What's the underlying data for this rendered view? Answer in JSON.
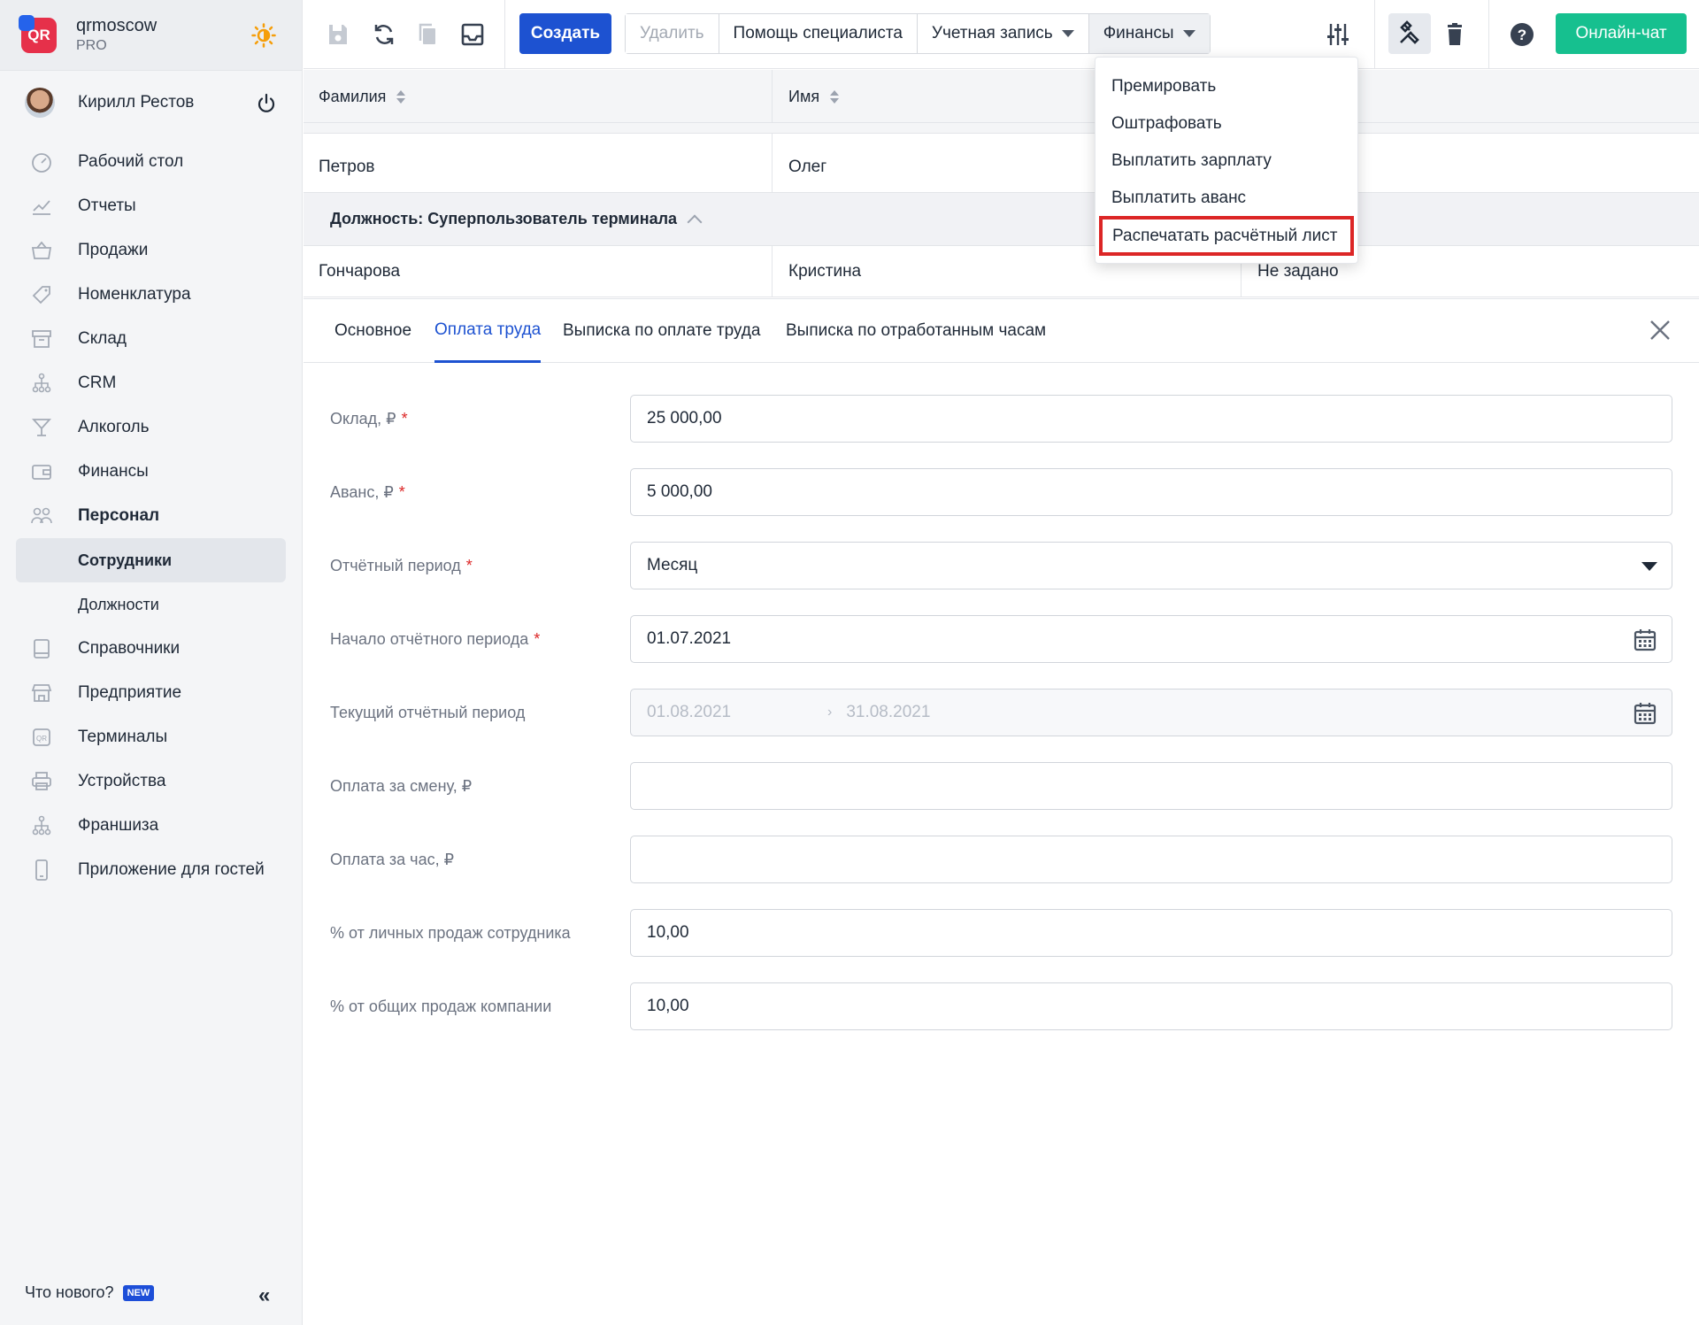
{
  "brand": {
    "name": "qrmoscow",
    "plan": "PRO",
    "logo_text": "QR"
  },
  "user": {
    "name": "Кирилл Рестов"
  },
  "nav": {
    "items": [
      {
        "label": "Рабочий стол",
        "icon": "dashboard-icon"
      },
      {
        "label": "Отчеты",
        "icon": "chart-icon"
      },
      {
        "label": "Продажи",
        "icon": "basket-icon"
      },
      {
        "label": "Номенклатура",
        "icon": "tag-icon"
      },
      {
        "label": "Склад",
        "icon": "archive-icon"
      },
      {
        "label": "CRM",
        "icon": "network-icon"
      },
      {
        "label": "Алкоголь",
        "icon": "cocktail-icon"
      },
      {
        "label": "Финансы",
        "icon": "wallet-icon"
      },
      {
        "label": "Персонал",
        "icon": "people-icon"
      }
    ],
    "sub": [
      {
        "label": "Сотрудники",
        "active": true
      },
      {
        "label": "Должности",
        "active": false
      }
    ],
    "items2": [
      {
        "label": "Справочники",
        "icon": "book-icon"
      },
      {
        "label": "Предприятие",
        "icon": "store-icon"
      },
      {
        "label": "Терминалы",
        "icon": "qr-terminal-icon"
      },
      {
        "label": "Устройства",
        "icon": "printer-icon"
      },
      {
        "label": "Франшиза",
        "icon": "network-icon"
      },
      {
        "label": "Приложение для гостей",
        "icon": "phone-icon"
      }
    ],
    "whats_new": "Что нового?",
    "new_badge": "NEW"
  },
  "toolbar": {
    "create": "Создать",
    "delete": "Удалить",
    "help": "Помощь специалиста",
    "account": "Учетная запись",
    "finance": "Финансы",
    "chat": "Онлайн-чат"
  },
  "table": {
    "headers": [
      "Фамилия",
      "Имя"
    ],
    "rows": [
      {
        "last": "Петров",
        "first": "Олег",
        "extra": ""
      },
      {
        "last": "Гончарова",
        "first": "Кристина",
        "extra": "Не задано"
      }
    ],
    "group_label": "Должность: Суперпользователь терминала"
  },
  "finance_menu": {
    "items": [
      "Премировать",
      "Оштрафовать",
      "Выплатить зарплату",
      "Выплатить аванс",
      "Распечатать расчётный лист"
    ],
    "highlighted_index": 4
  },
  "tabs": {
    "items": [
      "Основное",
      "Оплата труда",
      "Выписка по оплате труда",
      "Выписка по отработанным часам"
    ],
    "active": "Оплата труда"
  },
  "form": {
    "salary": {
      "label": "Оклад, ₽",
      "value": "25 000,00",
      "required": true
    },
    "advance": {
      "label": "Аванс, ₽",
      "value": "5 000,00",
      "required": true
    },
    "period": {
      "label": "Отчётный период",
      "value": "Месяц",
      "required": true
    },
    "period_start": {
      "label": "Начало отчётного периода",
      "value": "01.07.2021",
      "required": true
    },
    "current_period": {
      "label": "Текущий отчётный период",
      "from": "01.08.2021",
      "to": "31.08.2021"
    },
    "shift_pay": {
      "label": "Оплата за смену, ₽",
      "value": ""
    },
    "hour_pay": {
      "label": "Оплата за час, ₽",
      "value": ""
    },
    "personal_sales": {
      "label": "% от личных продаж сотрудника",
      "value": "10,00"
    },
    "company_sales": {
      "label": "% от общих продаж компании",
      "value": "10,00"
    }
  },
  "colors": {
    "primary": "#1d52d1",
    "chat": "#16c08f",
    "highlight": "#dc2626",
    "required": "#dc2626"
  }
}
